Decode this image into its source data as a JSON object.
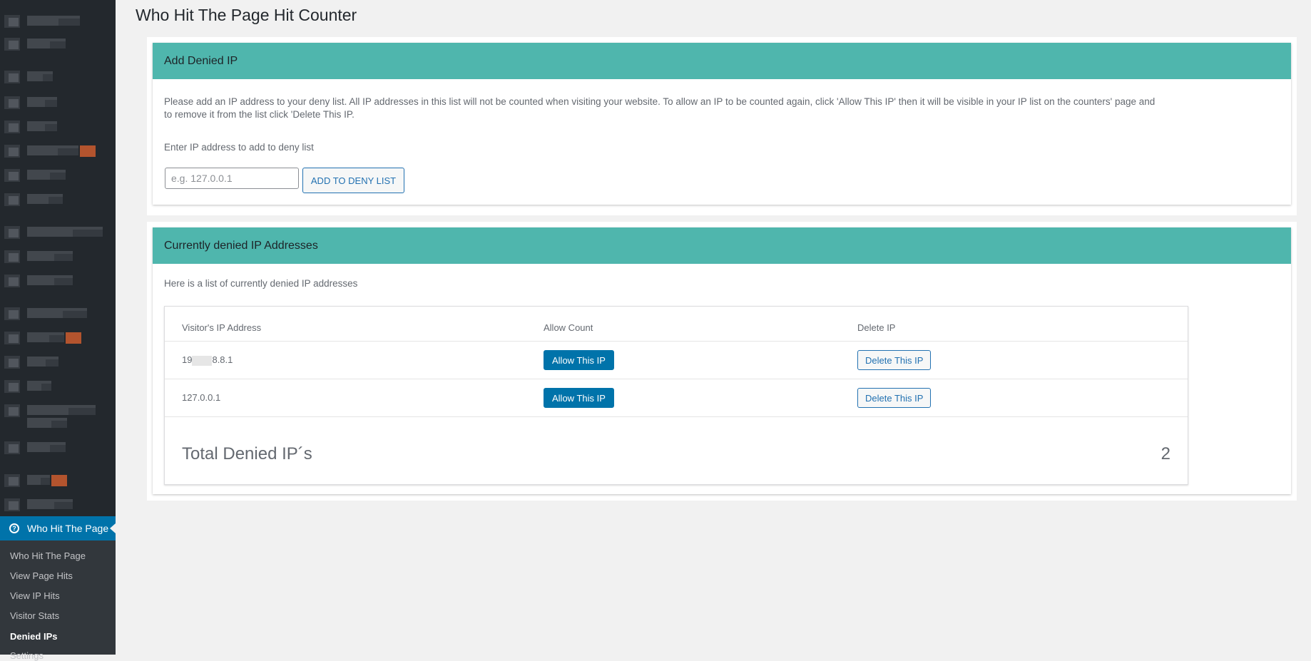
{
  "page": {
    "title": "Who Hit The Page Hit Counter"
  },
  "sidebar": {
    "current_menu": "Who Hit The Page",
    "submenu": [
      {
        "label": "Who Hit The Page"
      },
      {
        "label": "View Page Hits"
      },
      {
        "label": "View IP Hits"
      },
      {
        "label": "Visitor Stats"
      },
      {
        "label": "Denied IPs"
      },
      {
        "label": "Settings"
      }
    ]
  },
  "add_panel": {
    "header": "Add Denied IP",
    "description": "Please add an IP address to your deny list. All IP addresses in this list will not be counted when visiting your website. To allow an IP to be counted again, click 'Allow This IP' then it will be visible in your IP list on the counters' page and to remove it from the list click 'Delete This IP.",
    "input_label": "Enter IP address to add to deny list",
    "input_placeholder": "e.g. 127.0.0.1",
    "input_value": "",
    "button_label": "ADD TO DENY LIST"
  },
  "list_panel": {
    "header": "Currently denied IP Addresses",
    "description": "Here is a list of currently denied IP addresses",
    "columns": [
      "Visitor's IP Address",
      "Allow Count",
      "Delete IP"
    ],
    "rows": [
      {
        "ip_prefix": "19",
        "ip_suffix": "8.8.1",
        "allow_label": "Allow This IP",
        "delete_label": "Delete This IP"
      },
      {
        "ip_prefix": "127.0.0.1",
        "ip_suffix": "",
        "allow_label": "Allow This IP",
        "delete_label": "Delete This IP"
      }
    ],
    "total_label": "Total Denied IP´s",
    "total_value": "2"
  },
  "colors": {
    "panel_header": "#4fb6ad",
    "primary_button": "#0073aa",
    "sidebar_bg": "#23282d",
    "sidebar_active": "#0073aa"
  },
  "icons": {
    "current_menu_icon": "question-circle-icon"
  }
}
